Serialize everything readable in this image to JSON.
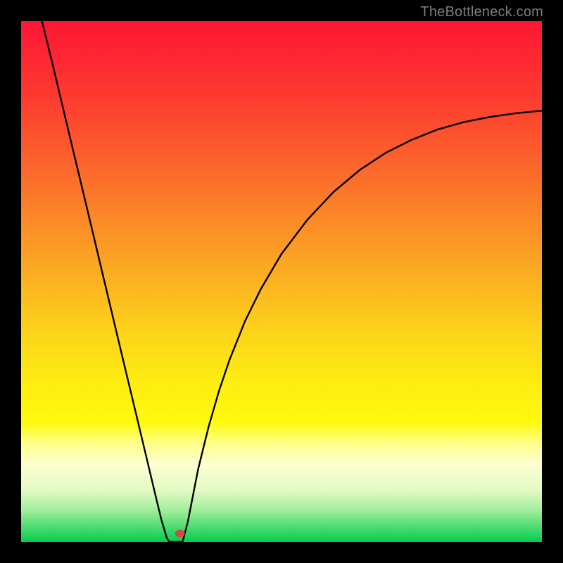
{
  "attribution": "TheBottleneck.com",
  "chart_data": {
    "type": "line",
    "title": "",
    "xlabel": "",
    "ylabel": "",
    "xlim": [
      0,
      100
    ],
    "ylim": [
      0,
      100
    ],
    "background_gradient": {
      "stops": [
        {
          "pos": 0.0,
          "color": "#fd1634"
        },
        {
          "pos": 0.15,
          "color": "#fc3c30"
        },
        {
          "pos": 0.3,
          "color": "#fb6d2b"
        },
        {
          "pos": 0.45,
          "color": "#fba124"
        },
        {
          "pos": 0.6,
          "color": "#fcd41a"
        },
        {
          "pos": 0.7,
          "color": "#feee11"
        },
        {
          "pos": 0.77,
          "color": "#fef90d"
        },
        {
          "pos": 0.81,
          "color": "#feff88"
        },
        {
          "pos": 0.85,
          "color": "#fefed2"
        },
        {
          "pos": 0.9,
          "color": "#e3fac3"
        },
        {
          "pos": 0.94,
          "color": "#a0ee9c"
        },
        {
          "pos": 0.97,
          "color": "#4fdd73"
        },
        {
          "pos": 1.0,
          "color": "#04cd4e"
        }
      ]
    },
    "series": [
      {
        "name": "bottleneck-curve",
        "color": "#000000",
        "x": [
          4.0,
          6.0,
          8.0,
          10.0,
          12.0,
          14.0,
          16.0,
          18.0,
          20.0,
          22.0,
          24.0,
          25.0,
          26.0,
          27.0,
          28.0,
          28.5,
          31.0,
          32.0,
          34.0,
          36.0,
          38.0,
          40.0,
          43.0,
          46.0,
          50.0,
          55.0,
          60.0,
          65.0,
          70.0,
          75.0,
          80.0,
          85.0,
          90.0,
          95.0,
          100.0
        ],
        "y_value": [
          100.0,
          91.9,
          83.5,
          75.1,
          66.8,
          58.4,
          50.0,
          41.6,
          33.2,
          24.9,
          16.5,
          12.3,
          8.1,
          4.0,
          0.7,
          0.0,
          0.0,
          3.8,
          14.0,
          22.1,
          29.0,
          34.9,
          42.4,
          48.5,
          55.3,
          61.9,
          67.2,
          71.4,
          74.7,
          77.2,
          79.2,
          80.6,
          81.6,
          82.3,
          82.8
        ]
      }
    ],
    "marker": {
      "name": "optimal-point",
      "x": 30.5,
      "y_value": 1.6,
      "rx": 7,
      "ry": 5.5,
      "color": "#cb4f43"
    }
  }
}
